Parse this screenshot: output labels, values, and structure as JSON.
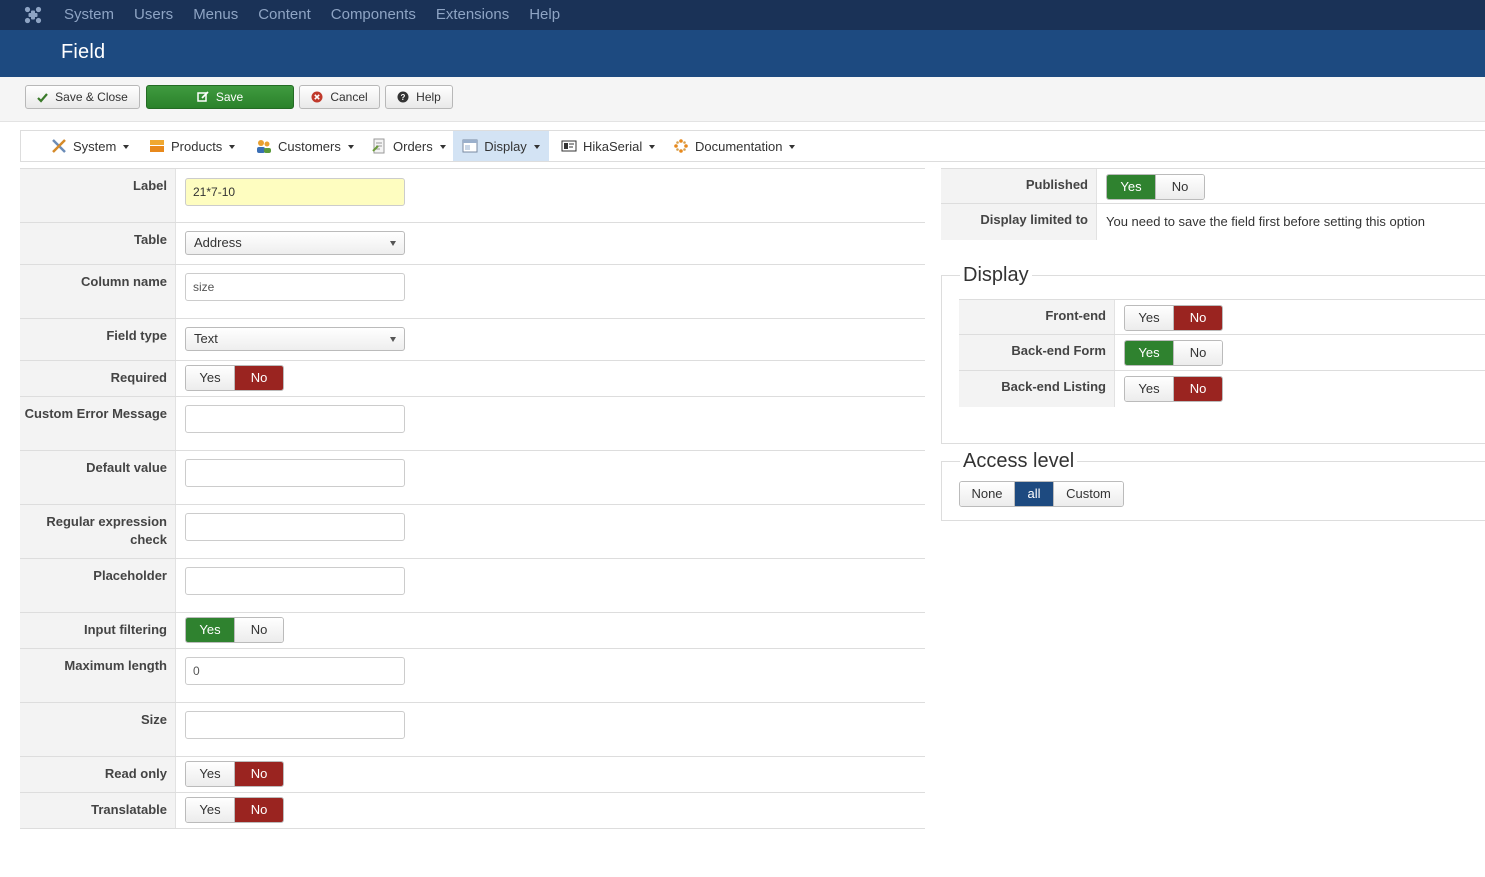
{
  "topnav": {
    "logo": "joomla-logo-icon",
    "items": [
      "System",
      "Users",
      "Menus",
      "Content",
      "Components",
      "Extensions",
      "Help"
    ]
  },
  "title": "Field",
  "toolbar": {
    "save_close": "Save & Close",
    "save": "Save",
    "cancel": "Cancel",
    "help": "Help"
  },
  "submenu": {
    "items": [
      {
        "label": "System",
        "icon": "tools-icon"
      },
      {
        "label": "Products",
        "icon": "products-icon"
      },
      {
        "label": "Customers",
        "icon": "customers-icon"
      },
      {
        "label": "Orders",
        "icon": "orders-icon"
      },
      {
        "label": "Display",
        "icon": "display-icon",
        "active": true
      },
      {
        "label": "HikaSerial",
        "icon": "hikaserial-icon"
      },
      {
        "label": "Documentation",
        "icon": "documentation-icon"
      }
    ]
  },
  "form": {
    "label": {
      "label": "Label",
      "value": "21*7-10"
    },
    "table": {
      "label": "Table",
      "value": "Address"
    },
    "column_name": {
      "label": "Column name",
      "value": "size"
    },
    "field_type": {
      "label": "Field type",
      "value": "Text"
    },
    "required": {
      "label": "Required",
      "value": "No"
    },
    "custom_error": {
      "label": "Custom Error Message",
      "value": ""
    },
    "default_value": {
      "label": "Default value",
      "value": ""
    },
    "regex": {
      "label": "Regular expression check",
      "value": ""
    },
    "placeholder": {
      "label": "Placeholder",
      "value": ""
    },
    "input_filtering": {
      "label": "Input filtering",
      "value": "Yes"
    },
    "max_length": {
      "label": "Maximum length",
      "value": "0"
    },
    "size": {
      "label": "Size",
      "value": ""
    },
    "read_only": {
      "label": "Read only",
      "value": "No"
    },
    "translatable": {
      "label": "Translatable",
      "value": "No"
    }
  },
  "yes_label": "Yes",
  "no_label": "No",
  "side": {
    "published": {
      "label": "Published",
      "value": "Yes"
    },
    "display_limited": {
      "label": "Display limited to",
      "text": "You need to save the field first before setting this option"
    },
    "display": {
      "title": "Display",
      "front_end": {
        "label": "Front-end",
        "value": "No"
      },
      "backend_form": {
        "label": "Back-end Form",
        "value": "Yes"
      },
      "backend_listing": {
        "label": "Back-end Listing",
        "value": "No"
      }
    },
    "access": {
      "title": "Access level",
      "options": [
        "None",
        "all",
        "Custom"
      ],
      "selected": "all"
    }
  },
  "colors": {
    "topnav": "#1a3257",
    "titlebar": "#1d4a80",
    "green": "#2f822f",
    "red": "#9a2420",
    "active_tab": "#d3e3f4",
    "highlight_input": "#fefdc0"
  }
}
